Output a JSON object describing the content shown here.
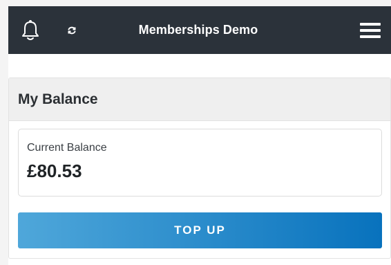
{
  "header": {
    "title": "Memberships Demo",
    "icons": {
      "left": "bell-icon",
      "second": "refresh-icon",
      "right": "hamburger-menu-icon"
    },
    "background_color": "#2b323a"
  },
  "balance_card": {
    "title": "My Balance",
    "current_balance_label": "Current Balance",
    "current_balance_value": "£80.53",
    "top_up_label": "TOP UP",
    "top_up_color": "#0872bd"
  }
}
